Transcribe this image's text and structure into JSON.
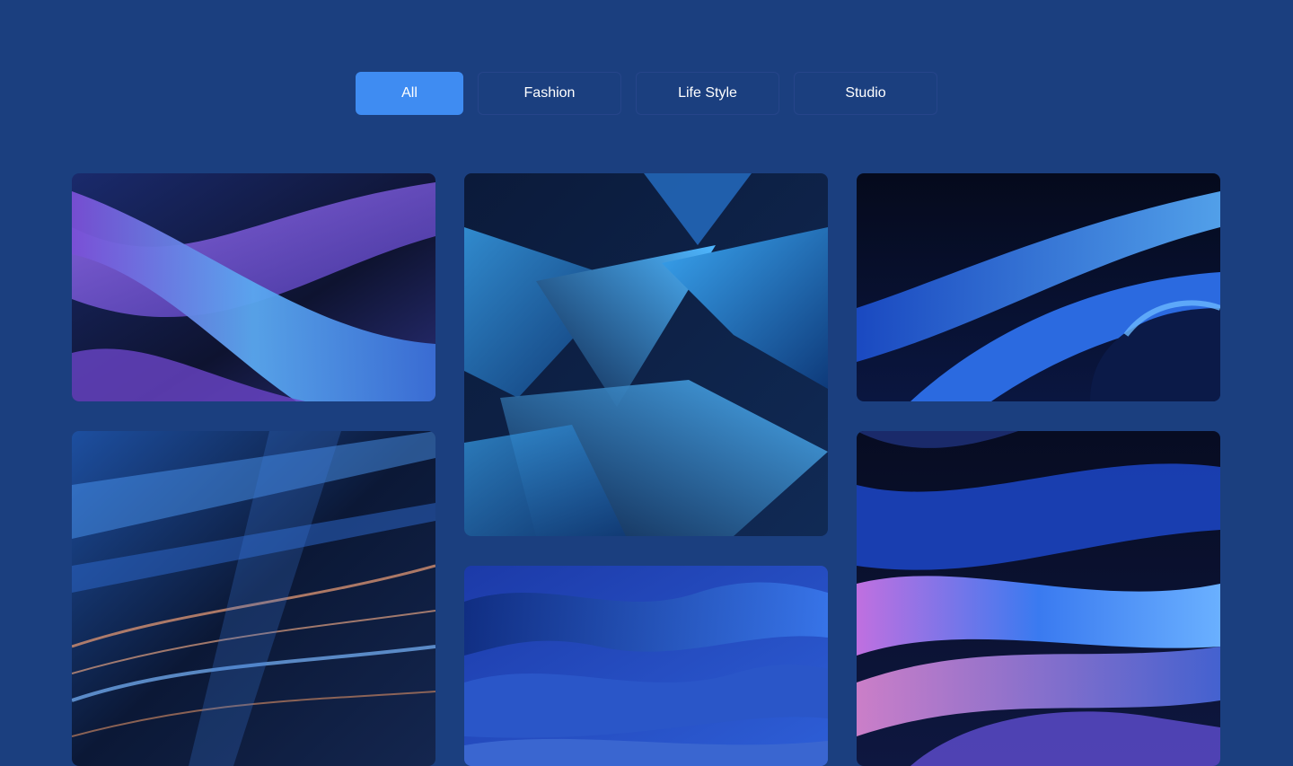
{
  "filters": [
    {
      "label": "All",
      "active": true
    },
    {
      "label": "Fashion",
      "active": false
    },
    {
      "label": "Life Style",
      "active": false
    },
    {
      "label": "Studio",
      "active": false
    }
  ],
  "gallery": {
    "images": [
      {
        "name": "abstract-wave-image-1",
        "style": "flowing purple-blue ribbon"
      },
      {
        "name": "abstract-shards-image-2",
        "style": "glassy blue angular shards"
      },
      {
        "name": "abstract-wave-image-3",
        "style": "dark blue swirling ribbons"
      },
      {
        "name": "abstract-streaks-image-4",
        "style": "blue and copper light streaks"
      },
      {
        "name": "abstract-dunes-image-5",
        "style": "blue wave dunes"
      },
      {
        "name": "abstract-ribbons-image-6",
        "style": "blue and pink folded ribbons"
      }
    ]
  }
}
